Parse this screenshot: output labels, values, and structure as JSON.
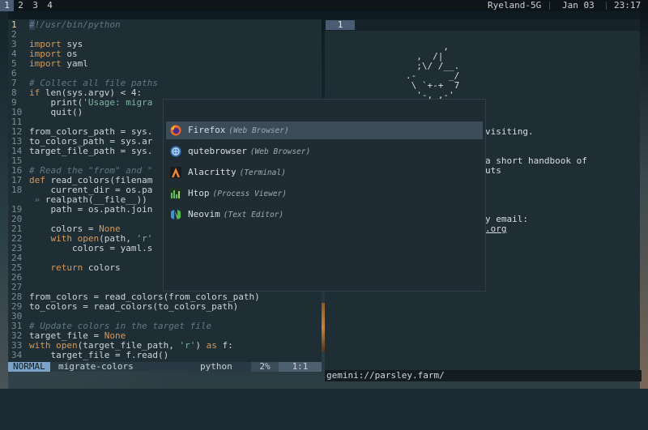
{
  "topbar": {
    "workspaces": [
      "1",
      "2",
      "3",
      "4"
    ],
    "active_workspace": "1",
    "network": "Ryeland-5G",
    "date": "Jan 03",
    "time": "23:17"
  },
  "editor": {
    "lines": [
      {
        "n": "1",
        "cur": true,
        "parts": [
          [
            "cursor",
            "#"
          ],
          [
            "cm",
            "!/usr/bin/python"
          ]
        ]
      },
      {
        "n": "2",
        "parts": []
      },
      {
        "n": "3",
        "parts": [
          [
            "kw",
            "import"
          ],
          [
            "txt",
            " sys"
          ]
        ]
      },
      {
        "n": "4",
        "parts": [
          [
            "kw",
            "import"
          ],
          [
            "txt",
            " os"
          ]
        ]
      },
      {
        "n": "5",
        "parts": [
          [
            "kw",
            "import"
          ],
          [
            "txt",
            " yaml"
          ]
        ]
      },
      {
        "n": "6",
        "parts": []
      },
      {
        "n": "7",
        "parts": [
          [
            "cm",
            "# Collect all file paths"
          ]
        ]
      },
      {
        "n": "8",
        "parts": [
          [
            "kw",
            "if"
          ],
          [
            "txt",
            " len(sys.argv) < 4:"
          ]
        ]
      },
      {
        "n": "9",
        "parts": [
          [
            "txt",
            "    print("
          ],
          [
            "st",
            "'Usage: migra"
          ]
        ]
      },
      {
        "n": "10",
        "parts": [
          [
            "txt",
            "    quit()"
          ]
        ]
      },
      {
        "n": "11",
        "parts": []
      },
      {
        "n": "12",
        "parts": [
          [
            "txt",
            "from_colors_path = sys."
          ]
        ]
      },
      {
        "n": "13",
        "parts": [
          [
            "txt",
            "to_colors_path = sys.ar"
          ]
        ]
      },
      {
        "n": "14",
        "parts": [
          [
            "txt",
            "target_file_path = sys."
          ]
        ]
      },
      {
        "n": "15",
        "parts": []
      },
      {
        "n": "16",
        "parts": [
          [
            "cm",
            "# Read the \"from\" and \""
          ]
        ]
      },
      {
        "n": "17",
        "parts": [
          [
            "kw",
            "def"
          ],
          [
            "txt",
            " read_colors(filenam"
          ]
        ]
      },
      {
        "n": "18",
        "parts": [
          [
            "txt",
            "    current_dir = os.pa"
          ]
        ]
      },
      {
        "n": "",
        "parts": [
          [
            "cm",
            " » "
          ],
          [
            "txt",
            "realpath(__file__))"
          ]
        ]
      },
      {
        "n": "19",
        "parts": [
          [
            "txt",
            "    path = os.path.join"
          ]
        ]
      },
      {
        "n": "20",
        "parts": []
      },
      {
        "n": "21",
        "parts": [
          [
            "txt",
            "    colors = "
          ],
          [
            "kw",
            "None"
          ]
        ]
      },
      {
        "n": "22",
        "parts": [
          [
            "txt",
            "    "
          ],
          [
            "kw",
            "with"
          ],
          [
            "txt",
            " "
          ],
          [
            "kw",
            "open"
          ],
          [
            "txt",
            "(path, "
          ],
          [
            "st",
            "'r'"
          ]
        ]
      },
      {
        "n": "23",
        "parts": [
          [
            "txt",
            "        colors = yaml.s"
          ]
        ]
      },
      {
        "n": "24",
        "parts": []
      },
      {
        "n": "25",
        "parts": [
          [
            "txt",
            "    "
          ],
          [
            "kw",
            "return"
          ],
          [
            "txt",
            " colors"
          ]
        ]
      },
      {
        "n": "26",
        "parts": []
      },
      {
        "n": "27",
        "parts": []
      },
      {
        "n": "28",
        "parts": [
          [
            "txt",
            "from_colors = read_colors(from_colors_path)"
          ]
        ]
      },
      {
        "n": "29",
        "parts": [
          [
            "txt",
            "to_colors = read_colors(to_colors_path)"
          ]
        ]
      },
      {
        "n": "30",
        "parts": []
      },
      {
        "n": "31",
        "parts": [
          [
            "cm",
            "# Update colors in the target file"
          ]
        ]
      },
      {
        "n": "32",
        "parts": [
          [
            "txt",
            "target_file = "
          ],
          [
            "kw",
            "None"
          ]
        ]
      },
      {
        "n": "33",
        "parts": [
          [
            "kw",
            "with"
          ],
          [
            "txt",
            " "
          ],
          [
            "kw",
            "open"
          ],
          [
            "txt",
            "(target_file_path, "
          ],
          [
            "st",
            "'r'"
          ],
          [
            "txt",
            ") "
          ],
          [
            "kw",
            "as"
          ],
          [
            "txt",
            " f:"
          ]
        ]
      },
      {
        "n": "34",
        "parts": [
          [
            "txt",
            "    target_file = f.read()"
          ]
        ]
      }
    ],
    "status": {
      "mode": "NORMAL",
      "file": "migrate-colors",
      "filetype": "python",
      "percent": "2%",
      "position": "1:1"
    }
  },
  "browser": {
    "tab": "1",
    "ascii_art": "       ,\n  ,  /|\n  ;\\/ /__.\n.-      _/\n \\ `+-+  7\n  '-,_,-'",
    "text": {
      "visiting": "visiting.",
      "handbook1": "a short handbook of",
      "handbook2": "uts",
      "email": "y email:",
      "org": ".org"
    },
    "url": "gemini://parsley.farm/"
  },
  "launcher": {
    "items": [
      {
        "name": "Firefox",
        "category": "(Web Browser)",
        "icon": "firefox-icon",
        "selected": true
      },
      {
        "name": "qutebrowser",
        "category": "(Web Browser)",
        "icon": "qutebrowser-icon",
        "selected": false
      },
      {
        "name": "Alacritty",
        "category": "(Terminal)",
        "icon": "alacritty-icon",
        "selected": false
      },
      {
        "name": "Htop",
        "category": "(Process Viewer)",
        "icon": "htop-icon",
        "selected": false
      },
      {
        "name": "Neovim",
        "category": "(Text Editor)",
        "icon": "neovim-icon",
        "selected": false
      }
    ]
  },
  "colors": {
    "accent": "#4a5c73",
    "mode_bg": "#7aa3c7",
    "keyword": "#d49a5b",
    "comment": "#5f7885",
    "string": "#7fb7a1"
  }
}
